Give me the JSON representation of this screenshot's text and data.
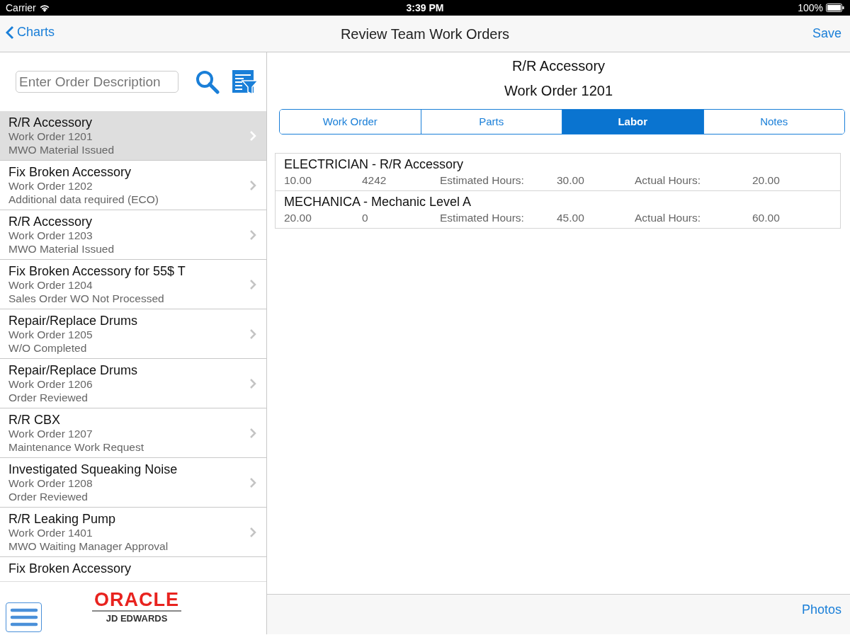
{
  "status_bar": {
    "carrier": "Carrier",
    "time": "3:39 PM",
    "battery": "100%"
  },
  "nav_bar": {
    "back": "Charts",
    "title": "Review Team Work Orders",
    "action": "Save"
  },
  "search": {
    "placeholder": "Enter Order Description"
  },
  "orders": [
    {
      "title": "R/R Accessory",
      "number": "Work Order 1201",
      "status": "MWO Material Issued",
      "selected": true
    },
    {
      "title": "Fix Broken Accessory",
      "number": "Work Order 1202",
      "status": "Additional data required (ECO)",
      "selected": false
    },
    {
      "title": "R/R Accessory",
      "number": "Work Order 1203",
      "status": "MWO Material Issued",
      "selected": false
    },
    {
      "title": "Fix Broken Accessory for 55$ T",
      "number": "Work Order 1204",
      "status": "Sales Order WO Not Processed",
      "selected": false
    },
    {
      "title": "Repair/Replace Drums",
      "number": "Work Order 1205",
      "status": "W/O Completed",
      "selected": false
    },
    {
      "title": "Repair/Replace Drums",
      "number": "Work Order 1206",
      "status": "Order Reviewed",
      "selected": false
    },
    {
      "title": "R/R CBX",
      "number": "Work Order 1207",
      "status": "Maintenance Work Request",
      "selected": false
    },
    {
      "title": "Investigated Squeaking Noise",
      "number": "Work Order 1208",
      "status": "Order Reviewed",
      "selected": false
    },
    {
      "title": "R/R Leaking Pump",
      "number": "Work Order 1401",
      "status": "MWO Waiting Manager Approval",
      "selected": false
    },
    {
      "title": "Fix Broken Accessory",
      "selected": false
    }
  ],
  "logo": {
    "brand": "ORACLE",
    "product": "JD EDWARDS"
  },
  "detail": {
    "title": "R/R Accessory",
    "subtitle": "Work Order 1201",
    "tabs": [
      {
        "label": "Work Order",
        "selected": false
      },
      {
        "label": "Parts",
        "selected": false
      },
      {
        "label": "Labor",
        "selected": true
      },
      {
        "label": "Notes",
        "selected": false
      }
    ],
    "labor": [
      {
        "name": "ELECTRICIAN - R/R Accessory",
        "column_1": "10.00",
        "column_2": "4242",
        "estimated_label": "Estimated Hours:",
        "estimated": "30.00",
        "actual_label": "Actual Hours:",
        "actual": "20.00"
      },
      {
        "name": "MECHANICA - Mechanic Level A",
        "column_1": "20.00",
        "column_2": "0",
        "estimated_label": "Estimated Hours:",
        "estimated": "45.00",
        "actual_label": "Actual Hours:",
        "actual": "60.00"
      }
    ]
  },
  "footer": {
    "photos": "Photos"
  }
}
